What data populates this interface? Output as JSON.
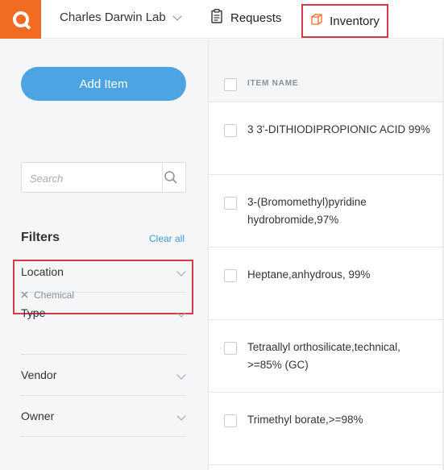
{
  "topbar": {
    "lab_name": "Charles Darwin Lab",
    "nav": {
      "requests": "Requests",
      "inventory": "Inventory"
    }
  },
  "sidebar": {
    "add_item": "Add Item",
    "search_placeholder": "Search",
    "filters_title": "Filters",
    "clear_all": "Clear all",
    "facets": [
      {
        "label": "Location"
      },
      {
        "label": "Type",
        "chip": "Chemical"
      },
      {
        "label": "Vendor"
      },
      {
        "label": "Owner"
      }
    ]
  },
  "table": {
    "column": "ITEM NAME",
    "rows": [
      {
        "name": "3 3'-DITHIODIPROPIONIC ACID 99%"
      },
      {
        "name": "3-(Bromomethyl)pyridine hydrobromide,97%"
      },
      {
        "name": "Heptane,anhydrous, 99%"
      },
      {
        "name": "Tetraallyl orthosilicate,technical, >=85% (GC)"
      },
      {
        "name": "Trimethyl borate,>=98%"
      }
    ]
  },
  "colors": {
    "brand": "#f26b23",
    "accent": "#4da4e2",
    "highlight": "#d43a47"
  },
  "icons": [
    "app-logo-icon",
    "chevron-down-icon",
    "clipboard-icon",
    "box-icon",
    "search-icon",
    "close-icon"
  ]
}
